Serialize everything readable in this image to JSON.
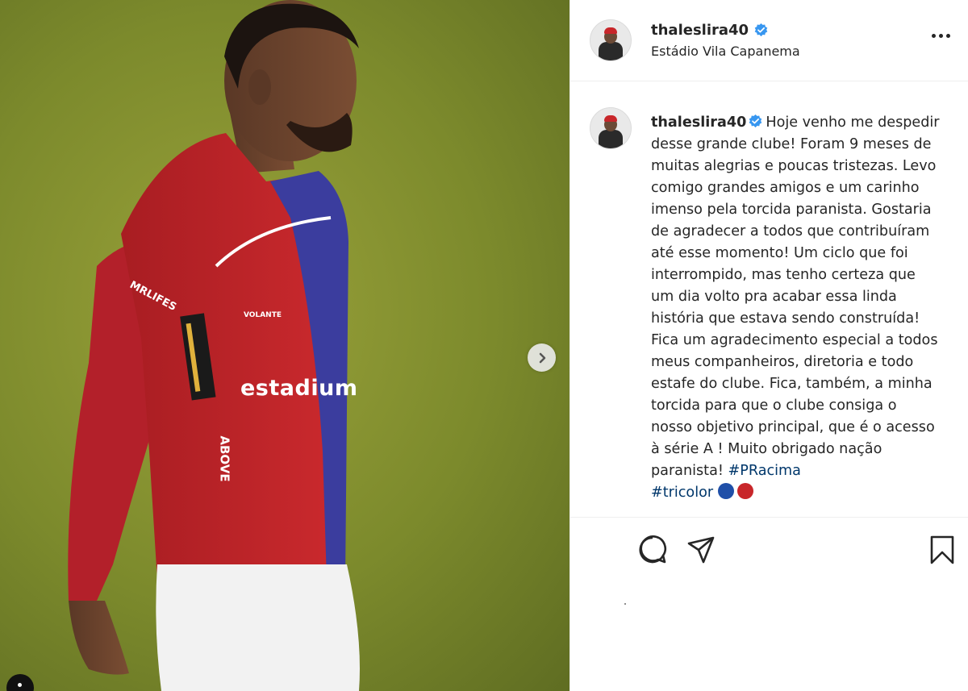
{
  "post": {
    "author": {
      "username": "thaleslira40",
      "verified_icon": "verified-badge-icon",
      "location": "Estádio Vila Capanema"
    },
    "more_options_icon": "more-options-icon",
    "media": {
      "next_icon": "chevron-right-icon",
      "visible_jersey_text": [
        "MRLIFES",
        "VOLANTE",
        "estadium",
        "ABOVE"
      ]
    },
    "caption": {
      "username": "thaleslira40",
      "text": "Hoje venho me despedir desse grande clube! Foram 9 meses de muitas alegrias e poucas tristezas. Levo comigo grandes amigos e um carinho imenso pela torcida paranista. Gostaria de agradecer a todos que contribuíram até esse momento! Um ciclo que foi interrompido, mas tenho certeza que um dia volto pra acabar essa linda história que estava sendo construída! Fica um agradecimento especial a todos meus companheiros, diretoria e todo estafe do clube. Fica, também, a minha torcida para que o clube consiga o nosso objetivo principal, que é o acesso à série A ! Muito obrigado nação paranista!",
      "hashtag": "#PRacima",
      "overflow_line": "#tricolor"
    },
    "actions": {
      "comment_icon": "comment-icon",
      "share_icon": "share-icon",
      "save_icon": "bookmark-icon"
    },
    "colors": {
      "text": "#262626",
      "hashtag": "#00376b",
      "verified": "#3897f0",
      "divider": "#efefef"
    }
  }
}
